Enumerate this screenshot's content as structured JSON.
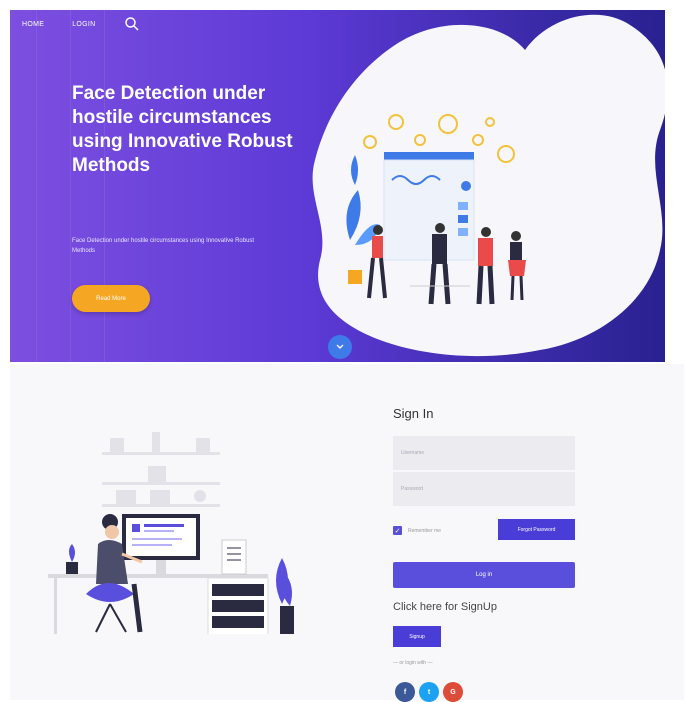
{
  "nav": {
    "home": "HOME",
    "login": "LOGIN",
    "search_icon": "search-icon"
  },
  "hero": {
    "title": "Face Detection under hostile circumstances using Innovative Robust Methods",
    "subtitle": "Face Detection under hostile circumstances using Innovative Robust Methods",
    "read_more": "Read More"
  },
  "signin": {
    "title": "Sign In",
    "username_placeholder": "Username",
    "password_placeholder": "Password",
    "remember_label": "Remember me",
    "forgot_label": "Forgot Password",
    "login_label": "Log in",
    "signup_prompt": "Click here for SignUp",
    "signup_label": "Signup",
    "or_login": "— or login with —",
    "social": [
      "f",
      "t",
      "G"
    ]
  },
  "colors": {
    "accent": "#4a3cd6",
    "cta": "#f5a623",
    "facebook": "#3b5998",
    "twitter": "#1da1f2",
    "google": "#dd4b39"
  }
}
